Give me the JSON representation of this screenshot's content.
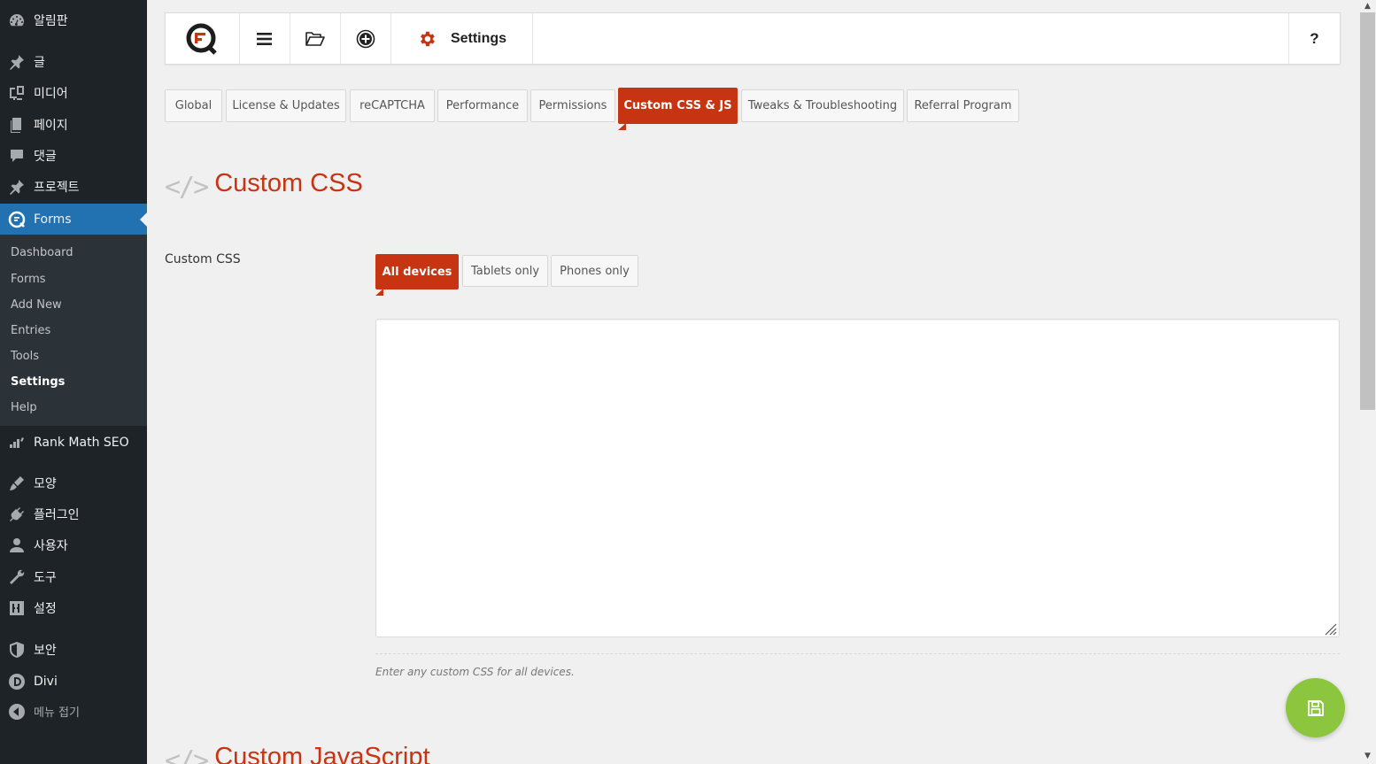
{
  "sidebar": {
    "items": [
      {
        "label": "알림판",
        "icon": "dashboard-icon"
      },
      {
        "label": "글",
        "icon": "pin-icon"
      },
      {
        "label": "미디어",
        "icon": "media-icon"
      },
      {
        "label": "페이지",
        "icon": "page-icon"
      },
      {
        "label": "댓글",
        "icon": "comment-icon"
      },
      {
        "label": "프로젝트",
        "icon": "pin-icon"
      },
      {
        "label": "Forms",
        "icon": "forms-logo-icon"
      },
      {
        "label": "Rank Math SEO",
        "icon": "rank-math-icon"
      },
      {
        "label": "모양",
        "icon": "brush-icon"
      },
      {
        "label": "플러그인",
        "icon": "plugin-icon"
      },
      {
        "label": "사용자",
        "icon": "user-icon"
      },
      {
        "label": "도구",
        "icon": "wrench-icon"
      },
      {
        "label": "설정",
        "icon": "settings-sliders-icon"
      },
      {
        "label": "보안",
        "icon": "shield-icon"
      },
      {
        "label": "Divi",
        "icon": "divi-icon"
      }
    ],
    "submenu": [
      "Dashboard",
      "Forms",
      "Add New",
      "Entries",
      "Tools",
      "Settings",
      "Help"
    ],
    "collapse_label": "메뉴 접기"
  },
  "toolbar": {
    "title": "Settings",
    "help": "?"
  },
  "tabs": [
    "Global",
    "License & Updates",
    "reCAPTCHA",
    "Performance",
    "Permissions",
    "Custom CSS & JS",
    "Tweaks & Troubleshooting",
    "Referral Program"
  ],
  "section": {
    "heading": "Custom CSS",
    "field_label": "Custom CSS",
    "device_tabs": [
      "All devices",
      "Tablets only",
      "Phones only"
    ],
    "css_value": "",
    "help_text": "Enter any custom CSS for all devices.",
    "next_heading": "Custom JavaScript"
  },
  "colors": {
    "accent": "#c73412",
    "wp_blue": "#2271b1",
    "sidebar_bg": "#1d2327",
    "save_green": "#8cc63f"
  }
}
